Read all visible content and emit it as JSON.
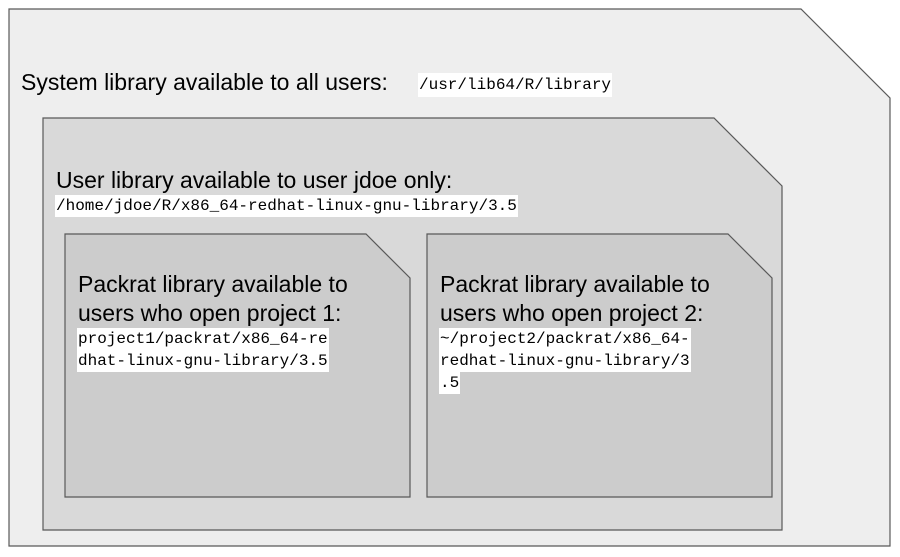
{
  "system": {
    "label": "System library available to all users:",
    "path": "/usr/lib64/R/library"
  },
  "user": {
    "label": "User library available to user jdoe only:",
    "path": "/home/jdoe/R/x86_64-redhat-linux-gnu-library/3.5"
  },
  "project1": {
    "label_lines": [
      "Packrat library available to",
      "users who open project 1:"
    ],
    "path_lines": [
      "project1/packrat/x86_64-re",
      "dhat-linux-gnu-library/3.5"
    ]
  },
  "project2": {
    "label_lines": [
      "Packrat library available to",
      "users who open project 2:"
    ],
    "path_lines": [
      "~/project2/packrat/x86_64-",
      "redhat-linux-gnu-library/3",
      ".5"
    ]
  },
  "colors": {
    "outer_fill": "#eeeeee",
    "inner_fill": "#d9d9d9",
    "project_fill": "#cccccc",
    "stroke": "#595959"
  }
}
